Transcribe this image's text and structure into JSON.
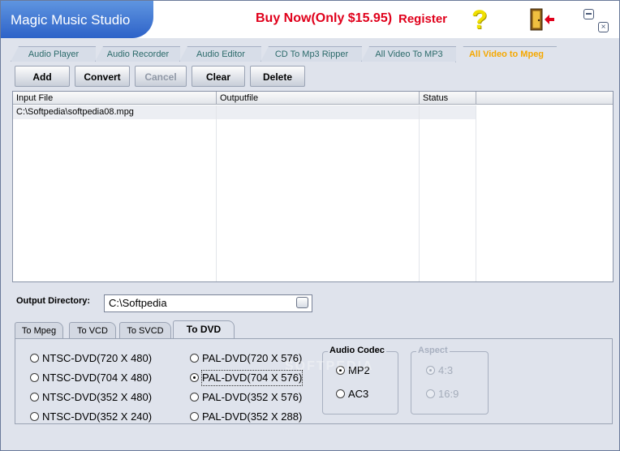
{
  "app": {
    "title": "Magic Music Studio",
    "buy_now": "Buy Now(Only $15.95)",
    "register": "Register",
    "help_icon": "?",
    "close_glyph": "×"
  },
  "tabs": [
    {
      "label": "Audio Player",
      "active": false
    },
    {
      "label": "Audio Recorder",
      "active": false
    },
    {
      "label": "Audio Editor",
      "active": false
    },
    {
      "label": "CD To Mp3 Ripper",
      "active": false
    },
    {
      "label": "All Video To MP3",
      "active": false
    },
    {
      "label": "All Video to Mpeg",
      "active": true
    }
  ],
  "toolbar": {
    "add": "Add",
    "convert": "Convert",
    "cancel": "Cancel",
    "clear": "Clear",
    "delete": "Delete"
  },
  "grid": {
    "columns": [
      "Input File",
      "Outputfile",
      "Status",
      ""
    ],
    "rows": [
      {
        "input": "C:\\Softpedia\\softpedia08.mpg",
        "output": "",
        "status": ""
      }
    ]
  },
  "output": {
    "label": "Output Directory:",
    "value": "C:\\Softpedia"
  },
  "subtabs": [
    {
      "label": "To Mpeg",
      "active": false
    },
    {
      "label": "To VCD",
      "active": false
    },
    {
      "label": "To SVCD",
      "active": false
    },
    {
      "label": "To DVD",
      "active": true
    }
  ],
  "dvd_formats": {
    "ntsc": [
      "NTSC-DVD(720 X 480)",
      "NTSC-DVD(704 X 480)",
      "NTSC-DVD(352 X 480)",
      "NTSC-DVD(352 X 240)"
    ],
    "pal": [
      "PAL-DVD(720 X 576)",
      "PAL-DVD(704 X 576)",
      "PAL-DVD(352 X 576)",
      "PAL-DVD(352 X 288)"
    ],
    "selected": "PAL-DVD(704 X 576)"
  },
  "audio_codec": {
    "title": "Audio Codec",
    "options": [
      "MP2",
      "AC3"
    ],
    "selected": "MP2"
  },
  "aspect": {
    "title": "Aspect",
    "options": [
      "4:3",
      "16:9"
    ],
    "selected": "4:3"
  },
  "watermark": "SOFTPEDIA"
}
